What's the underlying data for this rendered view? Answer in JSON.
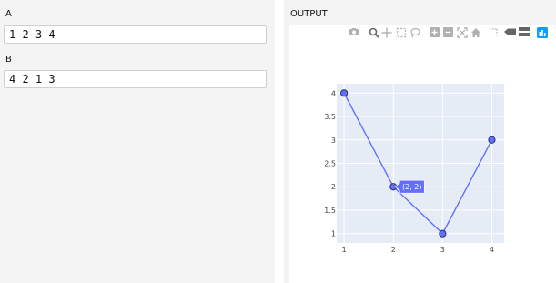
{
  "inputs": {
    "a": {
      "label": "A",
      "value": "1 2 3 4"
    },
    "b": {
      "label": "B",
      "value": "4 2 1 3"
    }
  },
  "output": {
    "label": "OUTPUT"
  },
  "toolbar": {
    "icons": [
      "camera-icon",
      "zoom-icon",
      "pan-icon",
      "box-select-icon",
      "lasso-select-icon",
      "zoom-in-icon",
      "zoom-out-icon",
      "autoscale-icon",
      "reset-axes-icon",
      "spike-lines-icon",
      "hover-closest-icon",
      "hover-compare-icon",
      "plotly-logo-icon"
    ]
  },
  "hover": {
    "label": "(2, 2)"
  },
  "colors": {
    "line": "#636efa",
    "plot_bg": "#e5ecf6",
    "hover_bg": "#636efa"
  },
  "chart_data": {
    "type": "line",
    "x": [
      1,
      2,
      3,
      4
    ],
    "series": [
      {
        "values": [
          4,
          2,
          1,
          3
        ]
      }
    ],
    "xlim": [
      0.85,
      4.25
    ],
    "ylim": [
      0.8,
      4.2
    ],
    "xticks": [
      "1",
      "2",
      "3",
      "4"
    ],
    "yticks": [
      "1",
      "1.5",
      "2",
      "2.5",
      "3",
      "3.5",
      "4"
    ],
    "grid": true,
    "markers": true
  }
}
